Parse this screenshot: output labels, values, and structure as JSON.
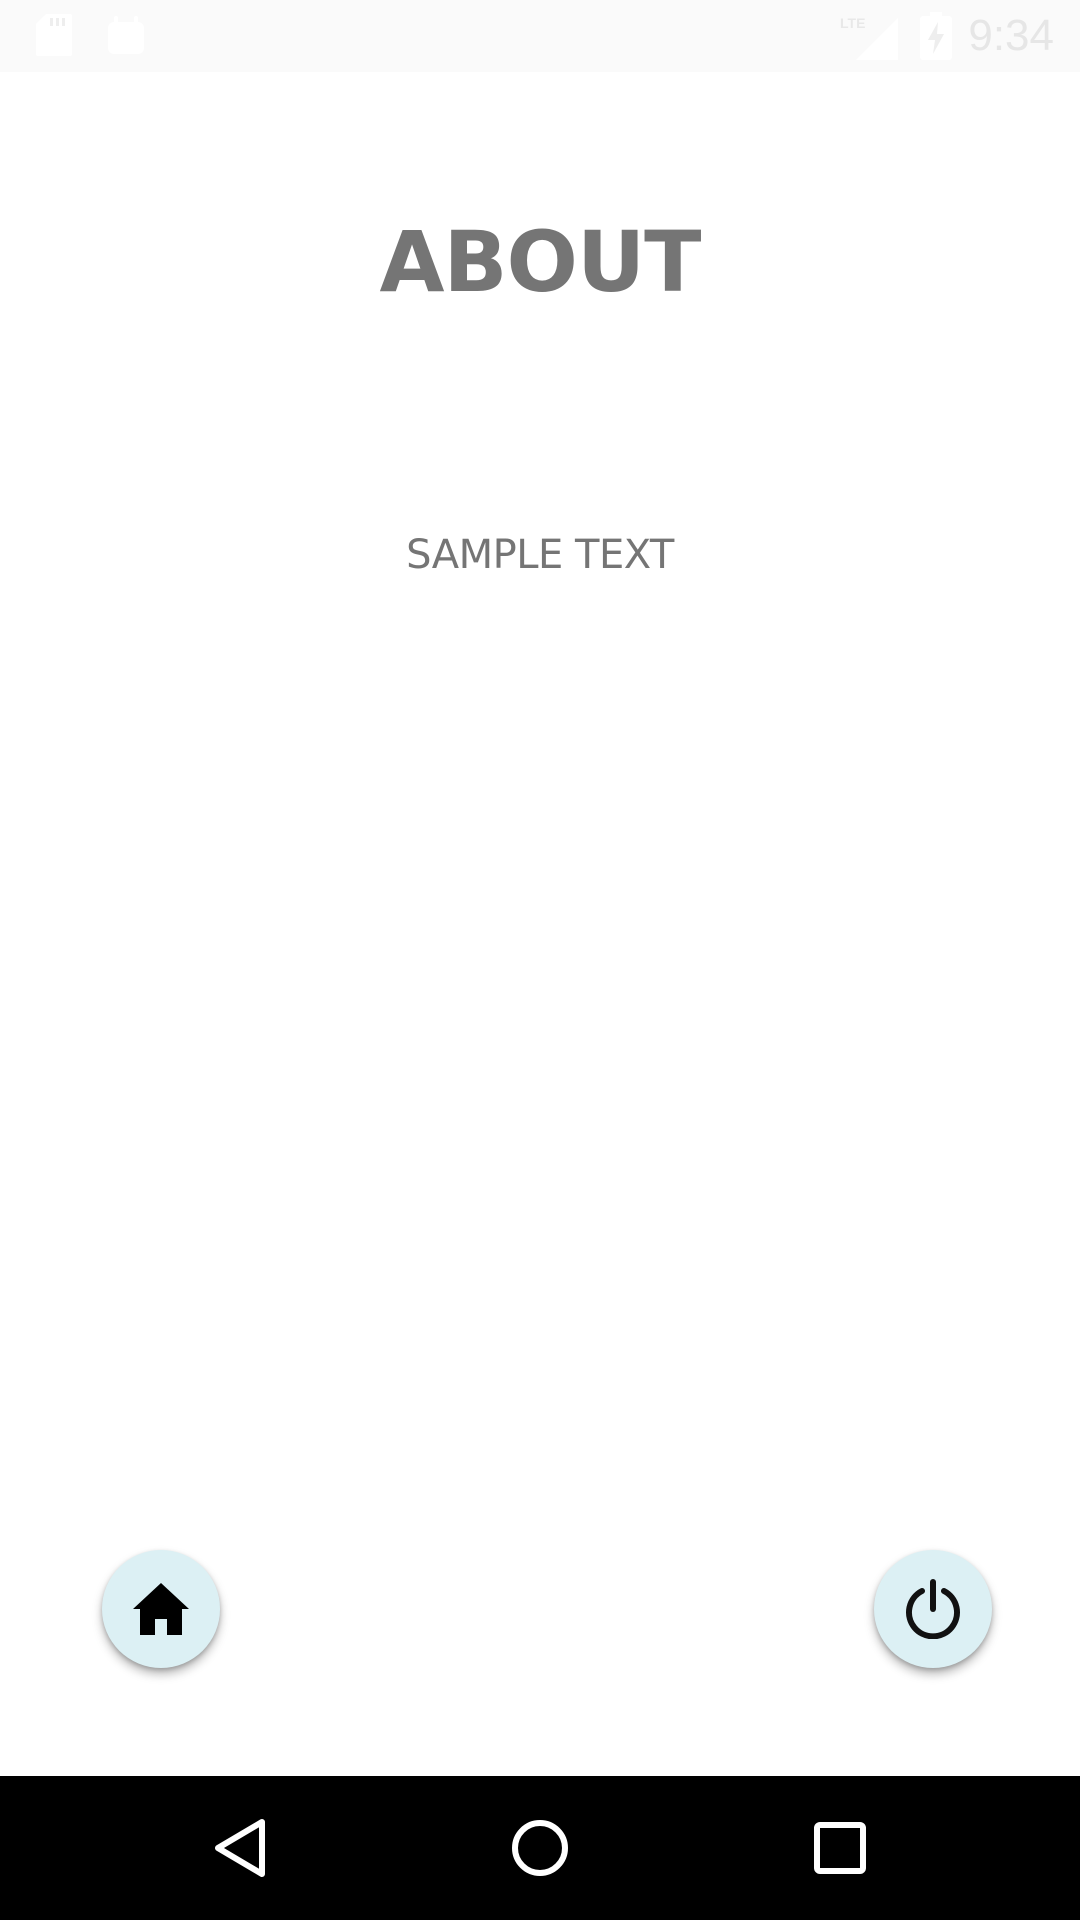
{
  "status_bar": {
    "time": "9:34",
    "icons": [
      "sd-card-icon",
      "notification-icon",
      "lte-signal-icon",
      "battery-charging-icon"
    ],
    "network_label": "LTE"
  },
  "page": {
    "title": "ABOUT",
    "body": "SAMPLE TEXT"
  },
  "fabs": {
    "home_icon": "home-icon",
    "power_icon": "power-icon",
    "background_color": "#dcf0f4"
  },
  "nav_bar": {
    "icons": [
      "back-icon",
      "home-circle-icon",
      "recents-icon"
    ]
  },
  "colors": {
    "title_text": "#757575",
    "status_bar_bg": "#fafafa",
    "nav_bar_bg": "#000000"
  }
}
